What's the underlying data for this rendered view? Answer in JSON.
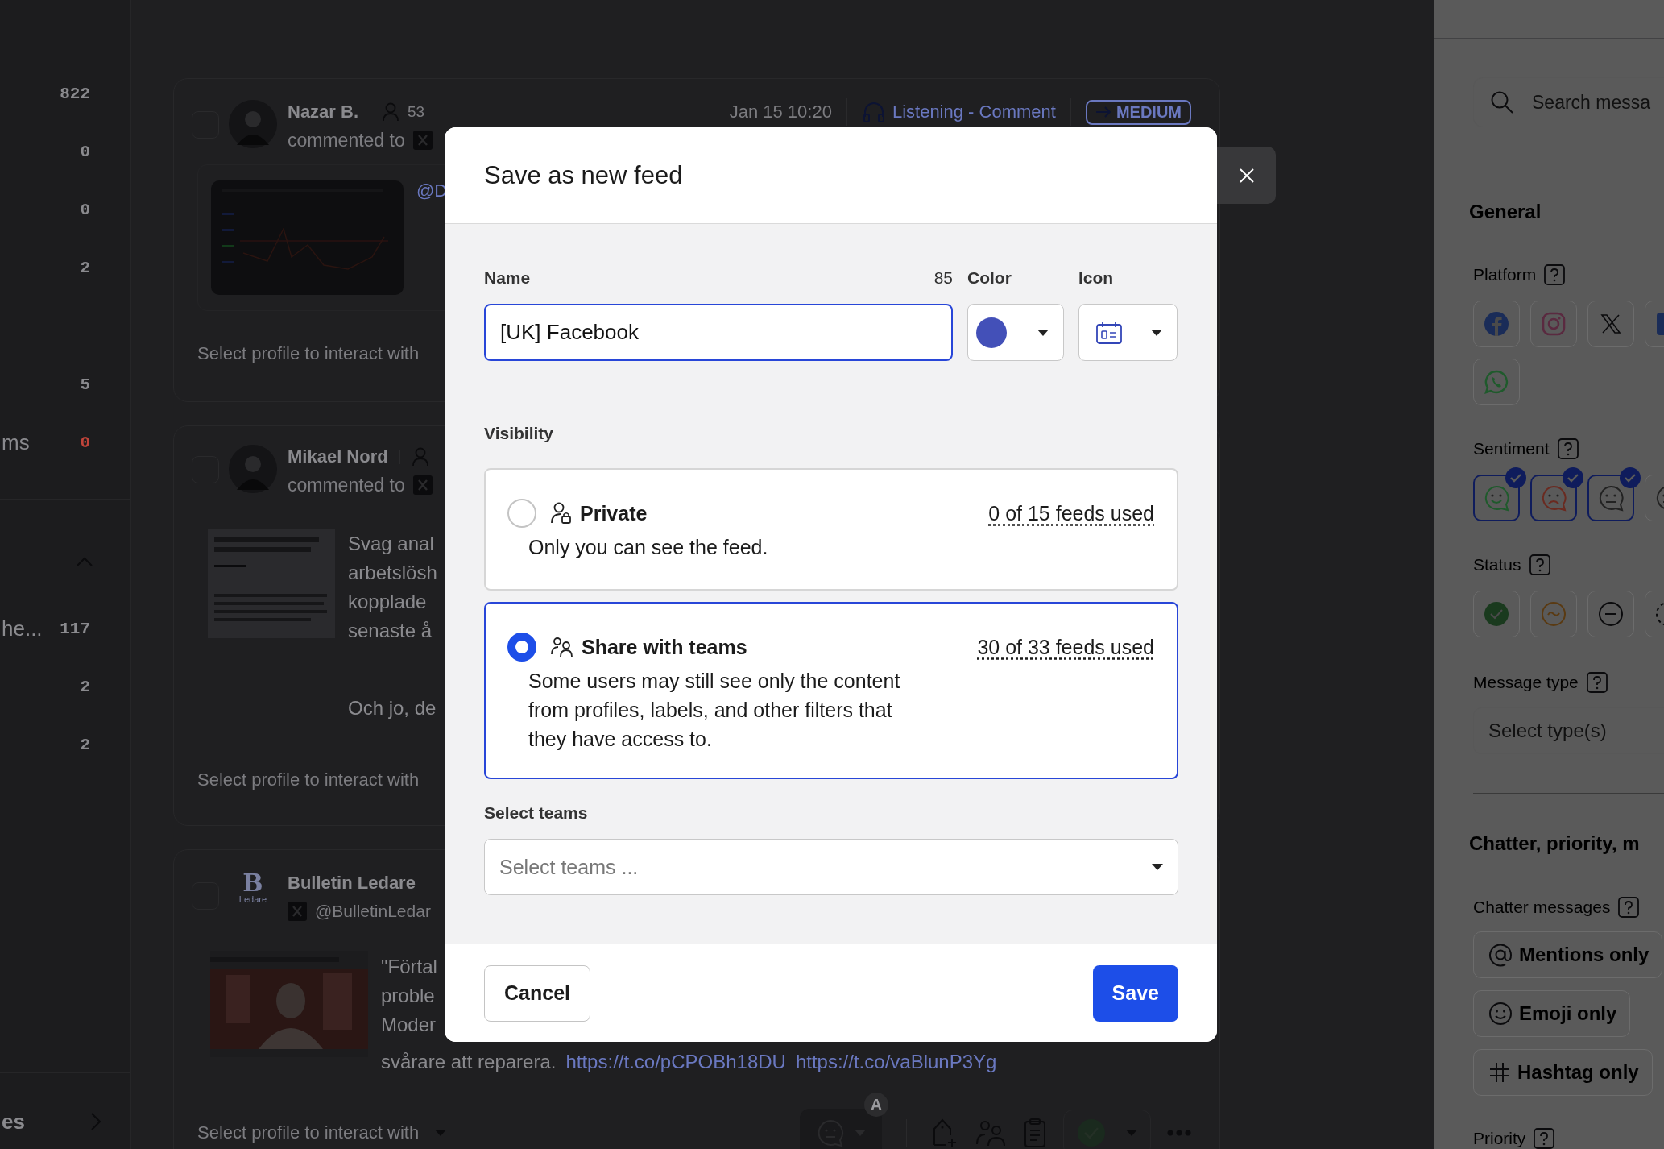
{
  "sidebar": {
    "sections": [
      {
        "items": [
          {
            "count": "822",
            "alert": false
          },
          {
            "count": "0",
            "alert": false
          },
          {
            "count": "0",
            "alert": false
          },
          {
            "count": "2",
            "alert": false
          }
        ]
      },
      {
        "items": [
          {
            "count": "5",
            "alert": false
          },
          {
            "label": "ms",
            "count": "0",
            "alert": true
          }
        ]
      },
      {
        "expanded": true,
        "items": [
          {
            "label": "he...",
            "count": "117",
            "alert": false
          },
          {
            "count": "2",
            "alert": false
          },
          {
            "count": "2",
            "alert": false
          }
        ]
      }
    ],
    "footer": {
      "label": "es"
    }
  },
  "feed": {
    "posts": [
      {
        "checked": false,
        "author": "Nazar B.",
        "followers": "53",
        "action": "commented to",
        "time": "Jan 15 10:20",
        "channel": "Listening - Comment",
        "priority": "MEDIUM",
        "link": "@D",
        "footer": "Select profile to interact with"
      },
      {
        "checked": false,
        "author": "Mikael Nord",
        "action": "commented to",
        "lines": [
          "Svag anal",
          "arbetslösh",
          "kopplade",
          "senaste å"
        ],
        "extra": "Och jo, de",
        "footer": "Select profile to interact with"
      },
      {
        "checked": false,
        "author": "Bulletin Ledare",
        "logo": {
          "letter": "B",
          "caption": "Ledare"
        },
        "handle": "@BulletinLedar",
        "lines": [
          "\"Förtal",
          "proble",
          "Moder"
        ],
        "tail": "svårare att reparera.",
        "links": [
          "https://t.co/pCPOBh18DU",
          "https://t.co/vaBlunP3Yg"
        ]
      }
    ],
    "actions": {
      "profile_placeholder": "Select profile to interact with",
      "badge": "A"
    }
  },
  "filters": {
    "search": {
      "placeholder": "Search messa"
    },
    "general": {
      "title": "General",
      "platform": {
        "label": "Platform",
        "options": [
          {
            "kind": "facebook",
            "selected": false
          },
          {
            "kind": "instagram",
            "selected": false
          },
          {
            "kind": "x",
            "selected": false
          },
          {
            "kind": "linkedin",
            "selected": false
          },
          {
            "kind": "whatsapp",
            "selected": false
          }
        ]
      },
      "sentiment": {
        "label": "Sentiment",
        "options": [
          {
            "kind": "positive",
            "selected": true
          },
          {
            "kind": "negative",
            "selected": true
          },
          {
            "kind": "neutral",
            "selected": true
          },
          {
            "kind": "mixed",
            "selected": false
          }
        ]
      },
      "status": {
        "label": "Status",
        "options": [
          {
            "kind": "done",
            "selected": false
          },
          {
            "kind": "pending",
            "selected": false
          },
          {
            "kind": "closed",
            "selected": false
          },
          {
            "kind": "open",
            "selected": false
          }
        ]
      },
      "message_type": {
        "label": "Message type",
        "placeholder": "Select type(s)"
      }
    },
    "chatter": {
      "title": "Chatter, priority, m",
      "messages": {
        "label": "Chatter messages",
        "options": [
          {
            "kind": "mention",
            "label": "Mentions only",
            "selected": false
          },
          {
            "kind": "emoji",
            "label": "Emoji only",
            "selected": false
          },
          {
            "kind": "hashtag",
            "label": "Hashtag only",
            "selected": false
          }
        ]
      },
      "priority": {
        "label": "Priority"
      }
    }
  },
  "dialog": {
    "title": "Save as new feed",
    "name": {
      "label": "Name",
      "counter": "85",
      "value": "[UK] Facebook"
    },
    "color": {
      "label": "Color",
      "color": "#4350b8"
    },
    "icon": {
      "label": "Icon"
    },
    "visibility": {
      "label": "Visibility",
      "options": [
        {
          "kind": "private",
          "title": "Private",
          "description": "Only you can see the feed.",
          "usage": "0 of 15 feeds used",
          "selected": false
        },
        {
          "kind": "teams",
          "title": "Share with teams",
          "description": "Some users may still see only the content from profiles, labels, and other filters that they have access to.",
          "usage": "30 of 33 feeds used",
          "selected": true
        }
      ]
    },
    "teams": {
      "label": "Select teams",
      "placeholder": "Select teams ..."
    },
    "buttons": [
      {
        "kind": "secondary",
        "label": "Cancel"
      },
      {
        "kind": "primary",
        "label": "Save"
      }
    ]
  }
}
